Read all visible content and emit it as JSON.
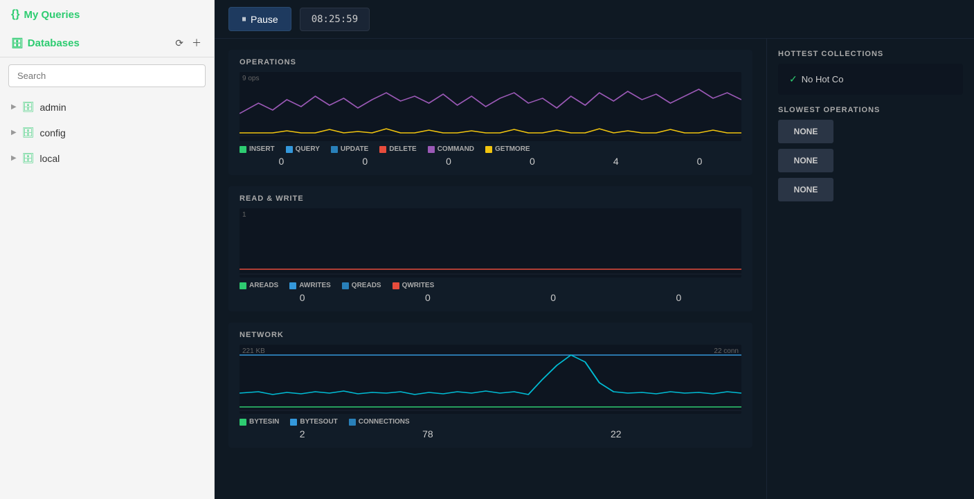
{
  "sidebar": {
    "myqueries_label": "My Queries",
    "databases_label": "Databases",
    "search_placeholder": "Search",
    "databases": [
      {
        "name": "admin"
      },
      {
        "name": "config"
      },
      {
        "name": "local"
      }
    ]
  },
  "header": {
    "pause_label": "Pause",
    "time_value": "08:25:59"
  },
  "operations_chart": {
    "title": "OPERATIONS",
    "y_label": "9 ops",
    "legend": [
      {
        "label": "INSERT",
        "color": "#2ecc71"
      },
      {
        "label": "QUERY",
        "color": "#3498db"
      },
      {
        "label": "UPDATE",
        "color": "#2980b9"
      },
      {
        "label": "DELETE",
        "color": "#e74c3c"
      },
      {
        "label": "COMMAND",
        "color": "#9b59b6"
      },
      {
        "label": "GETMORE",
        "color": "#f1c40f"
      }
    ],
    "values": [
      {
        "label": "INSERT",
        "value": "0"
      },
      {
        "label": "QUERY",
        "value": "0"
      },
      {
        "label": "UPDATE",
        "value": "0"
      },
      {
        "label": "DELETE",
        "value": "0"
      },
      {
        "label": "COMMAND",
        "value": "4"
      },
      {
        "label": "GETMORE",
        "value": "0"
      }
    ]
  },
  "read_write_chart": {
    "title": "READ & WRITE",
    "y_label": "1",
    "legend": [
      {
        "label": "AREADS",
        "color": "#2ecc71"
      },
      {
        "label": "AWRITES",
        "color": "#3498db"
      },
      {
        "label": "QREADS",
        "color": "#2980b9"
      },
      {
        "label": "QWRITES",
        "color": "#e74c3c"
      }
    ],
    "values": [
      {
        "label": "AREADS",
        "value": "0"
      },
      {
        "label": "AWRITES",
        "value": "0"
      },
      {
        "label": "QREADS",
        "value": "0"
      },
      {
        "label": "QWRITES",
        "value": "0"
      }
    ]
  },
  "network_chart": {
    "title": "NETWORK",
    "y_label": "221 KB",
    "y_label_right": "22 conn",
    "legend": [
      {
        "label": "BYTESIN",
        "color": "#2ecc71"
      },
      {
        "label": "BYTESOUT",
        "color": "#3498db"
      },
      {
        "label": "CONNECTIONS",
        "color": "#2980b9"
      }
    ],
    "values": [
      {
        "label": "BYTESIN",
        "value": "2"
      },
      {
        "label": "BYTESOUT",
        "value": "78"
      },
      {
        "label": "CONNECTIONS",
        "value": "22"
      }
    ]
  },
  "right_panel": {
    "hottest_title": "HOTTEST COLLECTIONS",
    "no_hot_label": "No Hot Co",
    "slowest_title": "SLOWEST OPERATIONS",
    "slowest_items": [
      {
        "label": "NONE"
      },
      {
        "label": "NONE"
      },
      {
        "label": "NONE"
      }
    ]
  }
}
